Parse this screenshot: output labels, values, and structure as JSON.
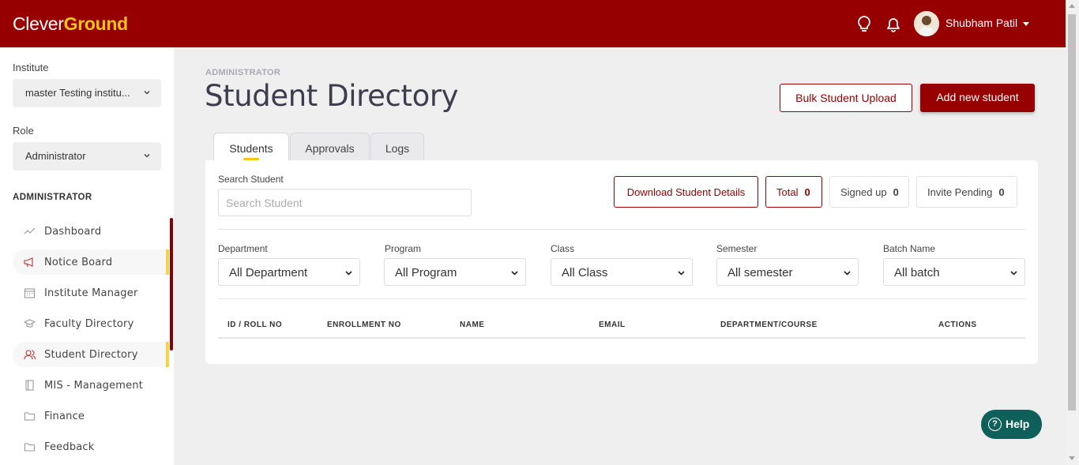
{
  "brand": {
    "part1": "Clever",
    "part2": "Ground"
  },
  "header": {
    "user_name": "Shubham Patil"
  },
  "sidebar": {
    "institute_label": "Institute",
    "institute_value": "master Testing institu...",
    "role_label": "Role",
    "role_value": "Administrator",
    "section_heading": "ADMINISTRATOR",
    "items": [
      {
        "label": "Dashboard",
        "icon": "trend-line-icon"
      },
      {
        "label": "Notice Board",
        "icon": "megaphone-icon"
      },
      {
        "label": "Institute Manager",
        "icon": "calendar-icon"
      },
      {
        "label": "Faculty Directory",
        "icon": "graduation-cap-icon"
      },
      {
        "label": "Student Directory",
        "icon": "users-icon"
      },
      {
        "label": "MIS - Management",
        "icon": "book-icon"
      },
      {
        "label": "Finance",
        "icon": "folder-icon"
      },
      {
        "label": "Feedback",
        "icon": "folder-icon"
      }
    ]
  },
  "page": {
    "breadcrumb": "ADMINISTRATOR",
    "title": "Student Directory",
    "bulk_upload_label": "Bulk Student Upload",
    "add_student_label": "Add new student",
    "tabs": [
      {
        "label": "Students"
      },
      {
        "label": "Approvals"
      },
      {
        "label": "Logs"
      }
    ]
  },
  "filters": {
    "search_label": "Search Student",
    "search_placeholder": "Search Student",
    "download_label": "Download Student Details",
    "stats": [
      {
        "label": "Total",
        "value": "0"
      },
      {
        "label": "Signed up",
        "value": "0"
      },
      {
        "label": "Invite Pending",
        "value": "0"
      }
    ],
    "dropdowns": [
      {
        "label": "Department",
        "value": "All Department"
      },
      {
        "label": "Program",
        "value": "All Program"
      },
      {
        "label": "Class",
        "value": "All Class"
      },
      {
        "label": "Semester",
        "value": "All semester"
      },
      {
        "label": "Batch Name",
        "value": "All batch"
      }
    ]
  },
  "table": {
    "columns": [
      "ID / ROLL NO",
      "ENROLLMENT NO",
      "NAME",
      "EMAIL",
      "DEPARTMENT/COURSE",
      "ACTIONS"
    ]
  },
  "help": {
    "label": "Help",
    "icon_glyph": "?"
  },
  "colors": {
    "brand": "#960000",
    "accent": "#f5c518",
    "help": "#0f5f5a"
  }
}
